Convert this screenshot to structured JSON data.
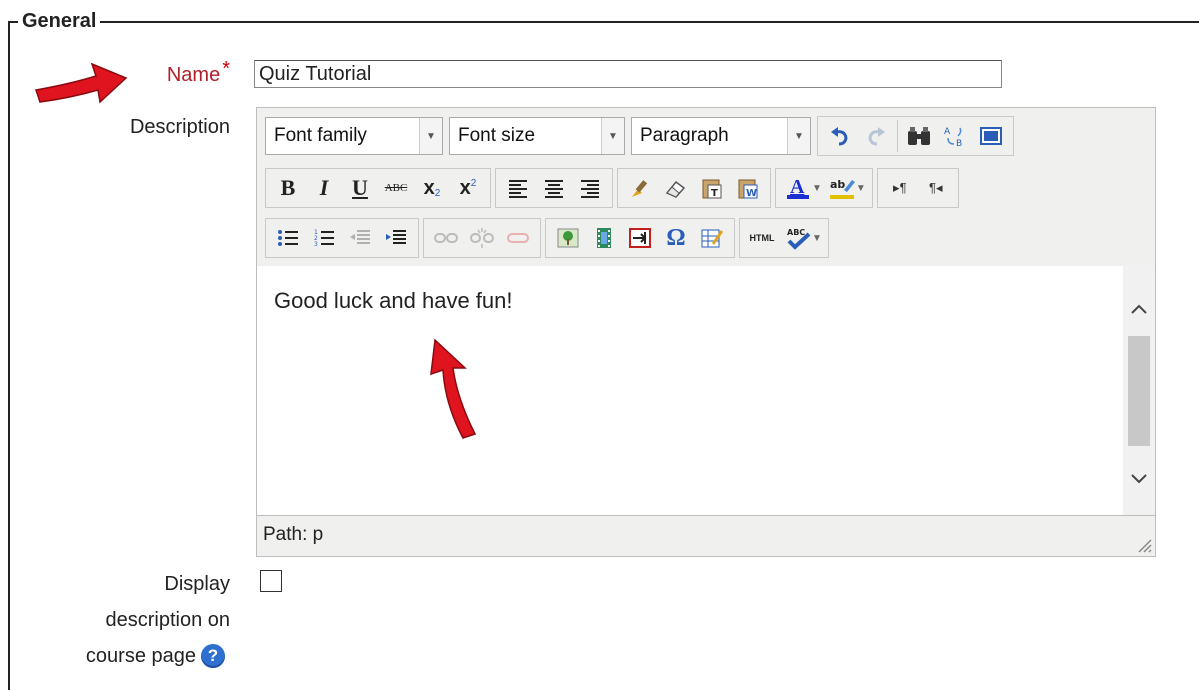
{
  "fieldset": {
    "legend": "General"
  },
  "name_field": {
    "label": "Name",
    "required_mark": "*",
    "value": "Quiz Tutorial"
  },
  "description_field": {
    "label": "Description"
  },
  "editor": {
    "font_family": "Font family",
    "font_size": "Font size",
    "format": "Paragraph",
    "content": "Good luck and have fun!",
    "path": "Path: p",
    "toolbar_row2_labels": {
      "bold": "B",
      "italic": "I",
      "underline": "U",
      "strikethrough": "ABC"
    }
  },
  "display_option": {
    "label_line1": "Display",
    "label_line2": "description on",
    "label_line3": "course page",
    "checked": false,
    "help_glyph": "?"
  },
  "colors": {
    "required_label": "#b0202a",
    "arrow": "#e0141e",
    "help_icon": "#2f6fd0",
    "text_color_underline": "#1c2fd0",
    "highlight_underline": "#e0c000"
  },
  "icons": [
    "arrow-annotation-icon",
    "undo-icon",
    "redo-icon",
    "find-icon",
    "replace-icon",
    "fullscreen-icon",
    "align-left-icon",
    "align-center-icon",
    "align-right-icon",
    "brush-icon",
    "eraser-icon",
    "paste-text-icon",
    "paste-word-icon",
    "text-color-icon",
    "highlight-color-icon",
    "ltr-icon",
    "rtl-icon",
    "bullet-list-icon",
    "numbered-list-icon",
    "outdent-icon",
    "indent-icon",
    "link-icon",
    "unlink-icon",
    "anchor-icon",
    "image-icon",
    "media-icon",
    "nonbreaking-icon",
    "omega-icon",
    "table-icon",
    "html-icon",
    "spellcheck-icon",
    "help-icon"
  ]
}
